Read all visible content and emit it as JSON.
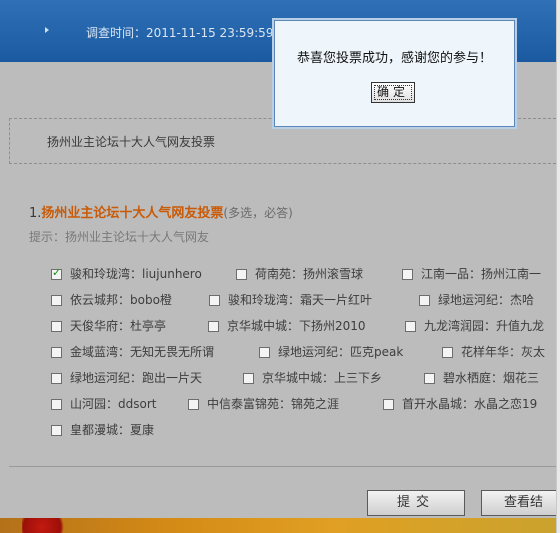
{
  "header": {
    "survey_time": "调查时间：2011-11-15 23:59:59"
  },
  "survey": {
    "title": "扬州业主论坛十大人气网友投票",
    "question_number": "1.",
    "question_title": "扬州业主论坛十大人气网友投票",
    "question_hint": "(多选，必答)",
    "tip": "提示：扬州业主论坛十大人气网友"
  },
  "options": [
    {
      "label": "骏和玲珑湾：liujunhero",
      "checked": true
    },
    {
      "label": "荷南苑：扬州滚雪球",
      "checked": false
    },
    {
      "label": "江南一品：扬州江南一",
      "checked": false
    },
    {
      "label": "依云城邦：bobo橙",
      "checked": false
    },
    {
      "label": "骏和玲珑湾：霜天一片红叶",
      "checked": false
    },
    {
      "label": "绿地运河纪：杰哈",
      "checked": false
    },
    {
      "label": "天俊华府：杜亭亭",
      "checked": false
    },
    {
      "label": "京华城中城：下扬州2010",
      "checked": false
    },
    {
      "label": "九龙湾润园：升值九龙",
      "checked": false
    },
    {
      "label": "金域蓝湾：无知无畏无所谓",
      "checked": false
    },
    {
      "label": "绿地运河纪：匹克peak",
      "checked": false
    },
    {
      "label": "花样年华：灰太",
      "checked": false
    },
    {
      "label": "绿地运河纪：跑出一片天",
      "checked": false
    },
    {
      "label": "京华城中城：上三下乡",
      "checked": false
    },
    {
      "label": "碧水栖庭：烟花三",
      "checked": false
    },
    {
      "label": "山河园：ddsort",
      "checked": false
    },
    {
      "label": "中信泰富锦苑：锦苑之涯",
      "checked": false
    },
    {
      "label": "首开水晶城：水晶之恋19",
      "checked": false
    },
    {
      "label": "皇都漫城：夏康",
      "checked": false
    }
  ],
  "buttons": {
    "submit": "提交",
    "results": "查看结"
  },
  "alert": {
    "message": "恭喜您投票成功，感谢您的参与！",
    "ok": "确定"
  },
  "colors": {
    "header_blue": "#1b5aa1",
    "question_orange": "#c95a07",
    "dialog_bg": "#eef5fb"
  }
}
